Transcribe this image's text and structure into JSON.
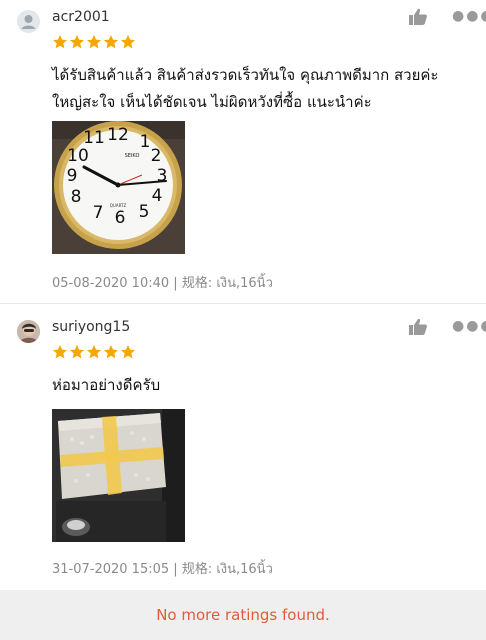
{
  "reviews": [
    {
      "username": "acr2001",
      "rating": 5,
      "comment_lines": [
        "ได้รับสินค้าแล้ว สินค้าส่งรวดเร็วทันใจ คุณภาพดีมาก สวยค่ะ",
        "ใหญ่สะใจ เห็นได้ชัดเจน ไม่ผิดหวังที่ซื้อ แนะนำค่ะ"
      ],
      "date": "05-08-2020 10:40",
      "variation": "规格: เงิน,16นิ้ว",
      "clock_face": {
        "brand": "SEIKO",
        "model": "QUARTZ",
        "numerals": [
          "12",
          "1",
          "2",
          "3",
          "4",
          "5",
          "6",
          "7",
          "8",
          "9",
          "10",
          "11"
        ]
      }
    },
    {
      "username": "suriyong15",
      "rating": 5,
      "comment_lines": [
        "ห่อมาอย่างดีครับ"
      ],
      "date": "31-07-2020 15:05",
      "variation": "规格: เงิน,16นิ้ว"
    }
  ],
  "footer": {
    "text": "No more ratings found."
  },
  "colors": {
    "star": "#f6a700",
    "accent": "#e25b3a",
    "meta_text": "#8a8a8a",
    "footer_bg": "#efefef"
  },
  "icons": {
    "like": "thumbs-up-icon",
    "more": "more-dots-icon",
    "star": "star-icon",
    "avatar": "user-avatar-icon"
  }
}
